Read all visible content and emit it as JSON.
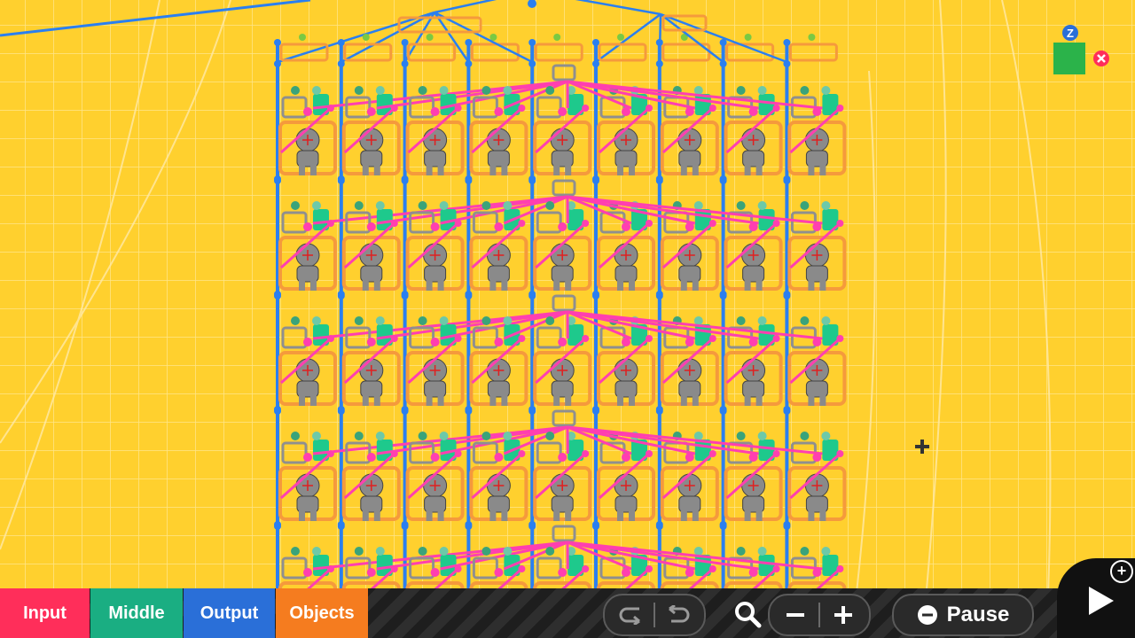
{
  "categories": [
    {
      "label": "Input",
      "color": "#ff2e5a"
    },
    {
      "label": "Middle",
      "color": "#1aae82"
    },
    {
      "label": "Output",
      "color": "#2a6fd8"
    },
    {
      "label": "Objects",
      "color": "#f57c1f"
    }
  ],
  "controls": {
    "undo_icon": "undo-icon",
    "redo_icon": "redo-icon",
    "zoom_icon": "magnifier-icon",
    "zoom_out_icon": "minus-icon",
    "zoom_in_icon": "plus-icon",
    "pause_label": "Pause",
    "play_icon": "play-icon",
    "add_icon": "plus-icon"
  },
  "marker": {
    "letter": "Z",
    "color": "#2bb34a"
  },
  "grid": {
    "rows": 5,
    "columns": 9
  },
  "colors": {
    "background": "#ffd02e",
    "wire_blue": "#2a7ff0",
    "wire_pink": "#ff3fb0",
    "node_orange": "#f59a3c",
    "node_gray": "#8f8f8f",
    "figure": "#8a8a8a"
  }
}
